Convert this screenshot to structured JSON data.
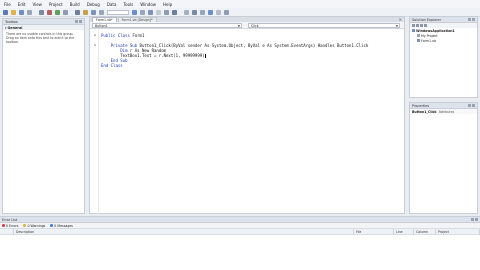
{
  "menu": [
    "File",
    "Edit",
    "View",
    "Project",
    "Build",
    "Debug",
    "Data",
    "Tools",
    "Window",
    "Help"
  ],
  "toolbar": {
    "colors": [
      "#5b7bb5",
      "#e0b04a",
      "#6c8fc7",
      "#9aa7ba",
      "#7a8aa0",
      "#b85d5d",
      "#5aa35a",
      "#8e9bb0",
      "#6d7f99",
      "#c9a04a",
      "#7d93b8",
      "#9aa7ba"
    ],
    "colors2": [
      "#6c8fc7",
      "#9aa7ba",
      "#7d93b8",
      "#c2cad6",
      "#8e9bb0",
      "#6d7f99",
      "#a5b0c0",
      "#7a8aa0",
      "#9aa7ba",
      "#6c8fc7",
      "#b4bccb",
      "#8e9bb0"
    ]
  },
  "toolbox": {
    "title": "Toolbox",
    "group": "General",
    "message": "There are no usable controls in this group. Drag an item onto this text to add it to the toolbox."
  },
  "editor": {
    "tabs": [
      {
        "label": "Form1.vb*",
        "active": true
      },
      {
        "label": "Form1.vb [Design]*",
        "active": false
      }
    ],
    "close_glyph": "×",
    "nav_left": "Button1",
    "nav_right": "Click",
    "lines": [
      {
        "kw": "Public Class",
        "text": " Form1"
      },
      {
        "kw": "",
        "text": ""
      },
      {
        "kw": "    Private Sub",
        "text": " Button1_Click(ByVal sender As System.Object, ByVal e As System.EventArgs) Handles Button1.Click"
      },
      {
        "kw": "        Dim",
        "text": " r As New Random"
      },
      {
        "kw": "",
        "text": "        TextBox1.Text = r.Next(1, 99999999)"
      },
      {
        "kw": "    End Sub",
        "text": ""
      },
      {
        "kw": "End Class",
        "text": ""
      }
    ]
  },
  "solution": {
    "title": "Solution Explorer",
    "items": [
      {
        "label": "WindowsApplication1",
        "color": "#6c8fc7",
        "bold": true
      },
      {
        "label": "My Project",
        "color": "#9aa7ba",
        "bold": false
      },
      {
        "label": "Form1.vb",
        "color": "#7d93b8",
        "bold": false
      }
    ]
  },
  "properties": {
    "title": "Properties",
    "object_name": "Button1_Click",
    "object_type": "Attributes"
  },
  "errors": {
    "title": "Error List",
    "tabs": [
      {
        "label": "0 Errors",
        "color": "#d23b3b"
      },
      {
        "label": "0 Warnings",
        "color": "#e3b23c"
      },
      {
        "label": "0 Messages",
        "color": "#3b7bd2"
      }
    ],
    "columns": [
      "",
      "Description",
      "File",
      "Line",
      "Column",
      "Project"
    ]
  }
}
